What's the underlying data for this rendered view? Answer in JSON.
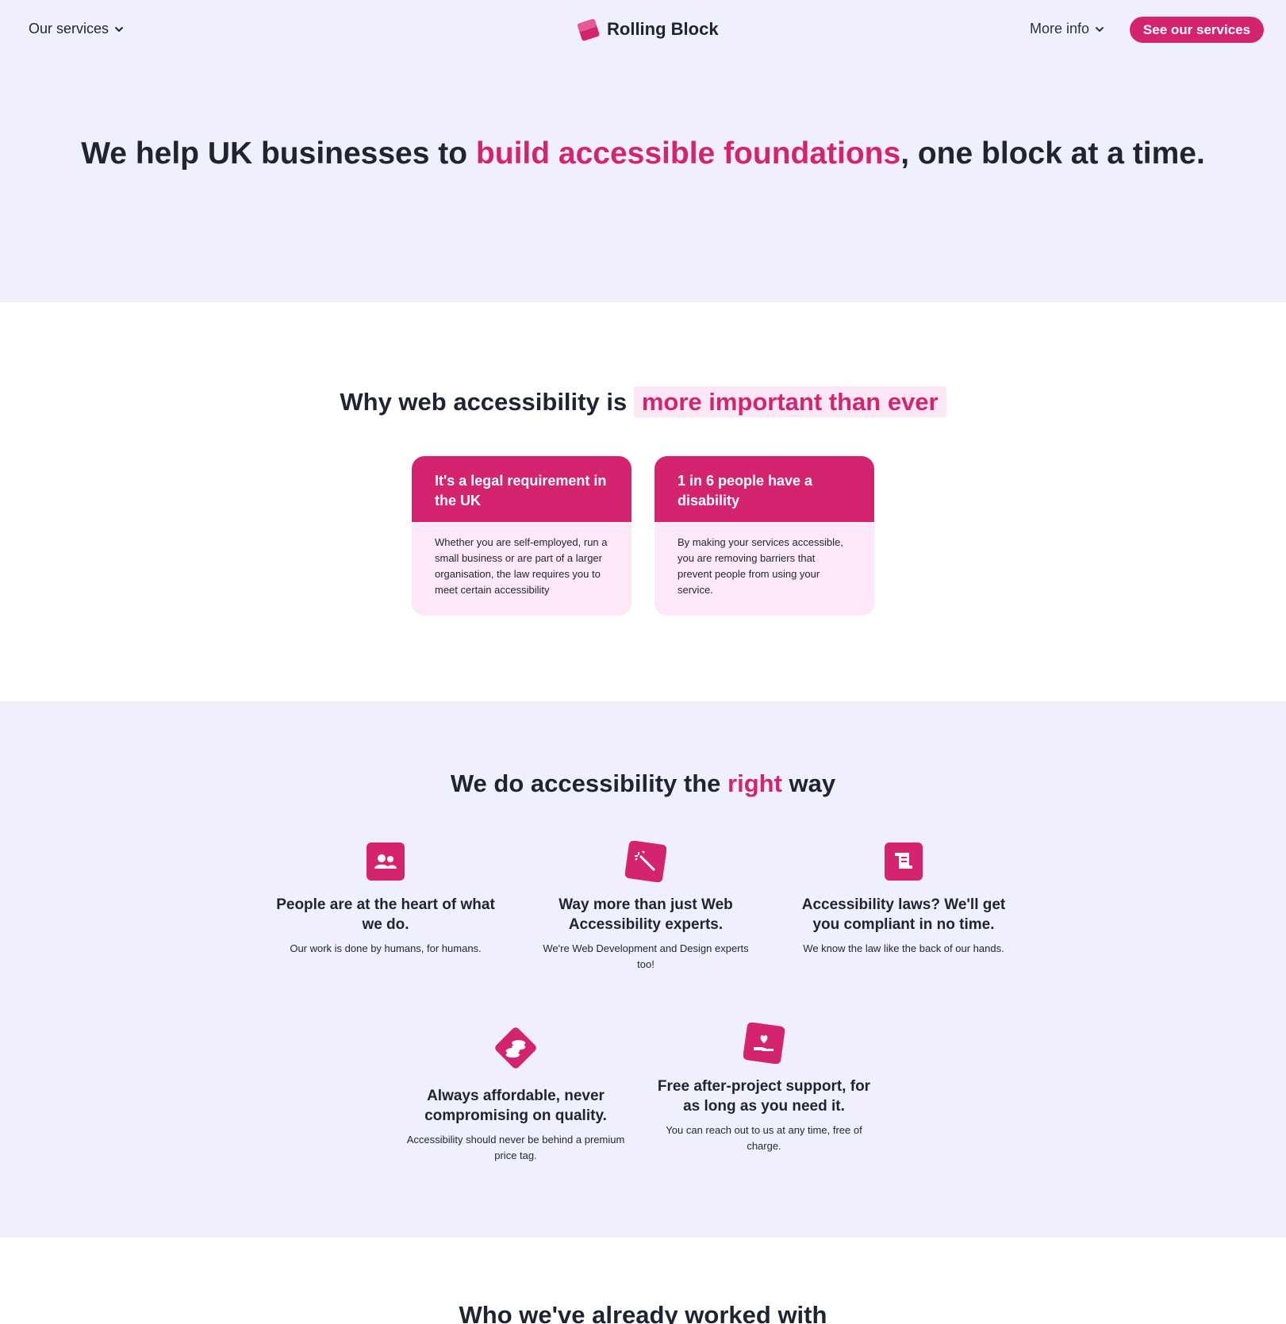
{
  "nav": {
    "services_label": "Our services",
    "brand": "Rolling Block",
    "more_info_label": "More info",
    "cta_label": "See our services"
  },
  "hero": {
    "title_part1": "We help UK businesses to ",
    "title_accent": "build accessible foundations",
    "title_part2": ", one block at a time."
  },
  "why": {
    "title_plain": "Why web accessibility is ",
    "title_highlight": "more important than ever",
    "cards": [
      {
        "heading": "It's a legal requirement in the UK",
        "body": "Whether you are self-employed, run a small business or are part of a larger organisation, the law requires you to meet certain accessibility"
      },
      {
        "heading": "1 in 6 people have a disability",
        "body": "By making your services accessible, you are removing barriers that prevent people from using your service."
      }
    ]
  },
  "right_way": {
    "title_part1": "We do accessibility the ",
    "title_accent": "right",
    "title_part2": " way",
    "features": [
      {
        "icon": "people-icon",
        "title": "People are at the heart of what we do.",
        "desc": "Our work is done by humans, for humans."
      },
      {
        "icon": "magic-wand-icon",
        "title": "Way more than just Web Accessibility experts.",
        "desc": "We're Web Development and Design experts too!"
      },
      {
        "icon": "scroll-icon",
        "title": "Accessibility laws? We'll get you compliant in no time.",
        "desc": "We know the law like the back of our hands."
      },
      {
        "icon": "coins-icon",
        "title": "Always affordable, never compromising on quality.",
        "desc": "Accessibility should never be behind a premium price tag."
      },
      {
        "icon": "hand-heart-icon",
        "title": "Free after-project support, for as long as you need it.",
        "desc": "You can reach out to us at any time, free of charge."
      }
    ]
  },
  "worked_with": {
    "title": "Who we've already worked with"
  },
  "colors": {
    "accent": "#d4246f",
    "hero_bg": "#f0effc",
    "card_body_bg": "#fce8f7",
    "text": "#1f2433"
  }
}
